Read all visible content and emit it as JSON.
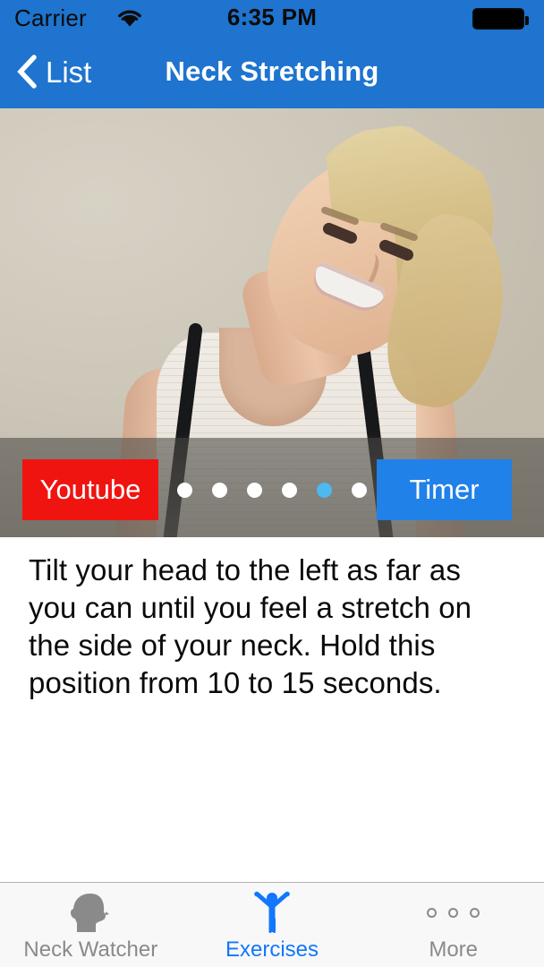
{
  "status_bar": {
    "carrier": "Carrier",
    "wifi_icon": "wifi-icon",
    "time": "6:35 PM",
    "battery_icon": "battery-full-icon"
  },
  "nav_bar": {
    "back_label": "List",
    "back_icon": "chevron-left-icon",
    "title": "Neck Stretching",
    "background_color": "#1E74CE"
  },
  "media": {
    "alt": "Woman tilting her head to the left performing a neck stretch",
    "overlay": {
      "youtube_button": {
        "label": "Youtube",
        "color": "#F01411"
      },
      "timer_button": {
        "label": "Timer",
        "color": "#2081E8"
      },
      "page_dots": {
        "total": 6,
        "active_index": 4,
        "active_color": "#4CB9F0",
        "inactive_color": "#FFFFFF"
      }
    }
  },
  "description": {
    "text": "Tilt your head to the left as far as you can until you feel a stretch on the side of your neck. Hold this position from 10 to 15 seconds."
  },
  "tab_bar": {
    "items": [
      {
        "label": "Neck Watcher",
        "icon": "head-silhouette-icon",
        "active": false
      },
      {
        "label": "Exercises",
        "icon": "person-arms-raised-icon",
        "active": true
      },
      {
        "label": "More",
        "icon": "more-dots-icon",
        "active": false
      }
    ],
    "active_color": "#1277FC",
    "inactive_color": "#8A8A8A"
  }
}
